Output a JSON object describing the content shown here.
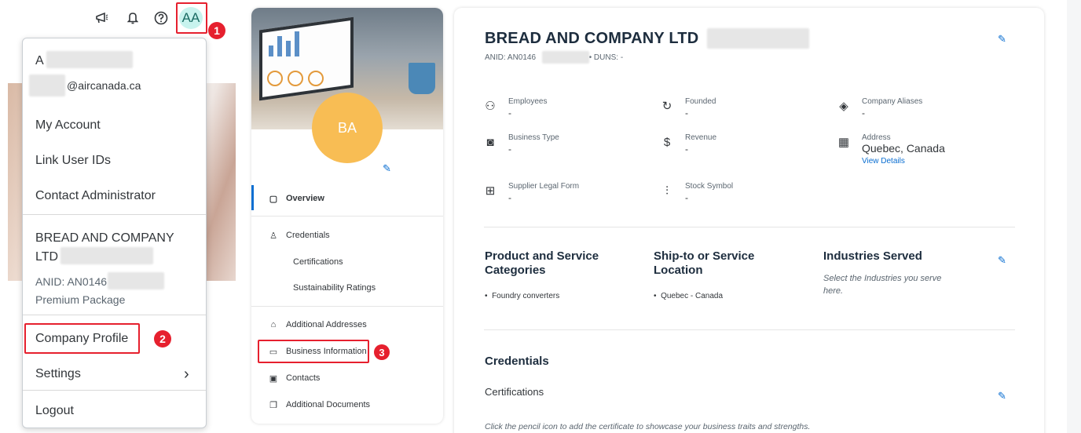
{
  "topbar": {
    "avatar_initials": "AA",
    "icons": [
      "megaphone-icon",
      "bell-icon",
      "help-icon"
    ]
  },
  "user_menu": {
    "name_initial": "A",
    "email_suffix": "@aircanada.ca",
    "items": {
      "my_account": "My Account",
      "link_user_ids": "Link User IDs",
      "contact_admin": "Contact Administrator"
    },
    "company_name_line1": "BREAD AND COMPANY",
    "company_name_line2": "LTD",
    "anid": "ANID: AN0146",
    "package": "Premium Package",
    "company_profile": "Company Profile",
    "settings": "Settings",
    "settings_chevron": "›",
    "logout": "Logout"
  },
  "steps": {
    "one": "1",
    "two": "2",
    "three": "3"
  },
  "profile_card": {
    "logo_initials": "BA",
    "nav": {
      "overview": "Overview",
      "credentials": "Credentials",
      "certifications": "Certifications",
      "sustainability": "Sustainability Ratings",
      "additional_addresses": "Additional Addresses",
      "business_information": "Business Information",
      "contacts": "Contacts",
      "additional_documents": "Additional Documents"
    }
  },
  "company": {
    "title": "BREAD AND COMPANY LTD",
    "anid_label": "ANID:",
    "anid_value": "AN0146",
    "duns_label": "DUNS:",
    "duns_value": "-",
    "fields": {
      "employees": {
        "label": "Employees",
        "value": "-"
      },
      "founded": {
        "label": "Founded",
        "value": "-"
      },
      "aliases": {
        "label": "Company Aliases",
        "value": "-"
      },
      "business_type": {
        "label": "Business Type",
        "value": "-"
      },
      "revenue": {
        "label": "Revenue",
        "value": "-"
      },
      "address": {
        "label": "Address",
        "value": "Quebec, Canada",
        "link": "View Details"
      },
      "legal_form": {
        "label": "Supplier Legal Form",
        "value": "-"
      },
      "stock_symbol": {
        "label": "Stock Symbol",
        "value": "-"
      }
    },
    "product_categories": {
      "title_l1": "Product and Service",
      "title_l2": "Categories",
      "item": "Foundry converters"
    },
    "ship_to": {
      "title_l1": "Ship-to or Service",
      "title_l2": "Location",
      "item": "Quebec - Canada"
    },
    "industries": {
      "title": "Industries Served",
      "hint_l1": "Select the Industries you serve",
      "hint_l2": "here."
    },
    "credentials_title": "Credentials",
    "certifications_title": "Certifications",
    "certifications_hint": "Click the pencil icon to add the certificate to showcase your business traits and strengths."
  },
  "colors": {
    "accent": "#0a6ed1",
    "highlight": "#e6202e",
    "logo": "#f8bd54",
    "avatar": "#c8f3ee"
  }
}
